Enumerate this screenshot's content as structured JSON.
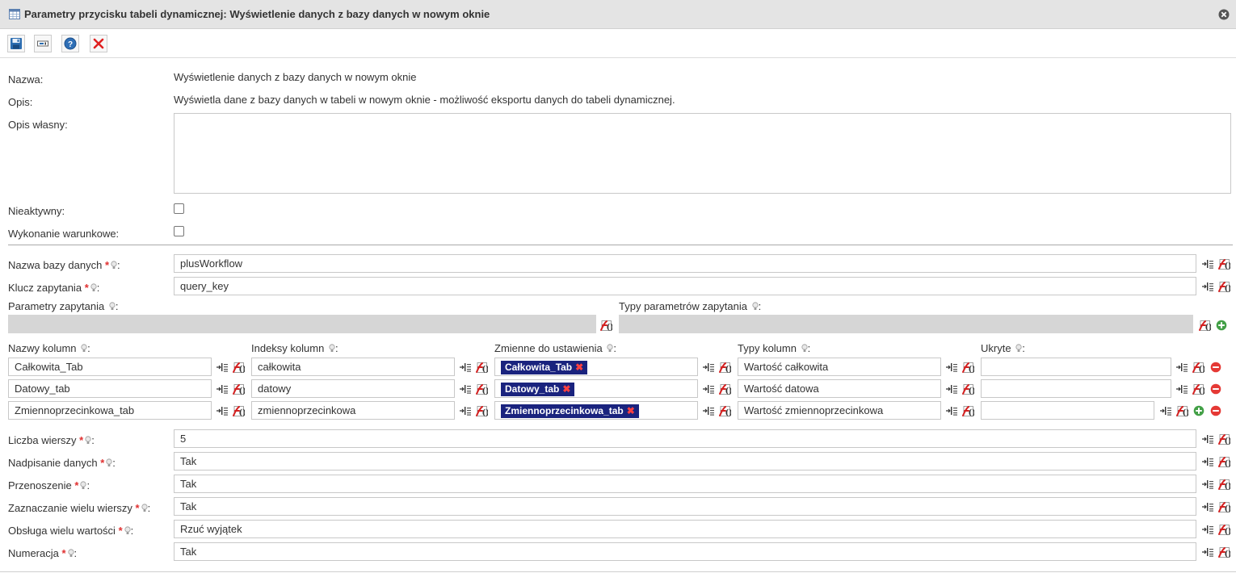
{
  "window": {
    "title": "Parametry przycisku tabeli dynamicznej: Wyświetlenie danych z bazy danych w nowym oknie"
  },
  "toolbar": {
    "icons": [
      "save-icon",
      "action-icon",
      "help-icon",
      "delete-icon"
    ]
  },
  "fields": {
    "nazwa": {
      "label": "Nazwa:",
      "value": "Wyświetlenie danych z bazy danych w nowym oknie"
    },
    "opis": {
      "label": "Opis:",
      "value": "Wyświetla dane z bazy danych w tabeli w nowym oknie - możliwość eksportu danych do tabeli dynamicznej."
    },
    "opis_wlasny": {
      "label": "Opis własny:",
      "value": ""
    },
    "nieaktywny": {
      "label": "Nieaktywny:",
      "checked": false
    },
    "wykonanie": {
      "label": "Wykonanie warunkowe:",
      "checked": false
    }
  },
  "db": {
    "nazwa_bazy": {
      "label": "Nazwa bazy danych",
      "value": "plusWorkflow"
    },
    "klucz": {
      "label": "Klucz zapytania",
      "value": "query_key"
    },
    "parametry": {
      "label": "Parametry zapytania"
    },
    "typy_parametrow": {
      "label": "Typy parametrów zapytania"
    }
  },
  "columns": {
    "headers": [
      "Nazwy kolumn",
      "Indeksy kolumn",
      "Zmienne do ustawienia",
      "Typy kolumn",
      "Ukryte"
    ],
    "rows": [
      {
        "name": "Całkowita_Tab",
        "index": "całkowita",
        "variable": "Całkowita_Tab",
        "type": "Wartość całkowita",
        "hidden": ""
      },
      {
        "name": "Datowy_tab",
        "index": "datowy",
        "variable": "Datowy_tab",
        "type": "Wartość datowa",
        "hidden": ""
      },
      {
        "name": "Zmiennoprzecinkowa_tab",
        "index": "zmiennoprzecinkowa",
        "variable": "Zmiennoprzecinkowa_tab",
        "type": "Wartość zmiennoprzecinkowa",
        "hidden": ""
      }
    ]
  },
  "options": [
    {
      "label": "Liczba wierszy",
      "value": "5"
    },
    {
      "label": "Nadpisanie danych",
      "value": "Tak"
    },
    {
      "label": "Przenoszenie",
      "value": "Tak"
    },
    {
      "label": "Zaznaczanie wielu wierszy",
      "value": "Tak"
    },
    {
      "label": "Obsługa wielu wartości",
      "value": "Rzuć wyjątek"
    },
    {
      "label": "Numeracja",
      "value": "Tak"
    }
  ],
  "required_mark": "*",
  "colors": {
    "tag_bg": "#1a237e",
    "accent_red": "#e03030",
    "titlebar_bg": "#e4e4e4"
  }
}
